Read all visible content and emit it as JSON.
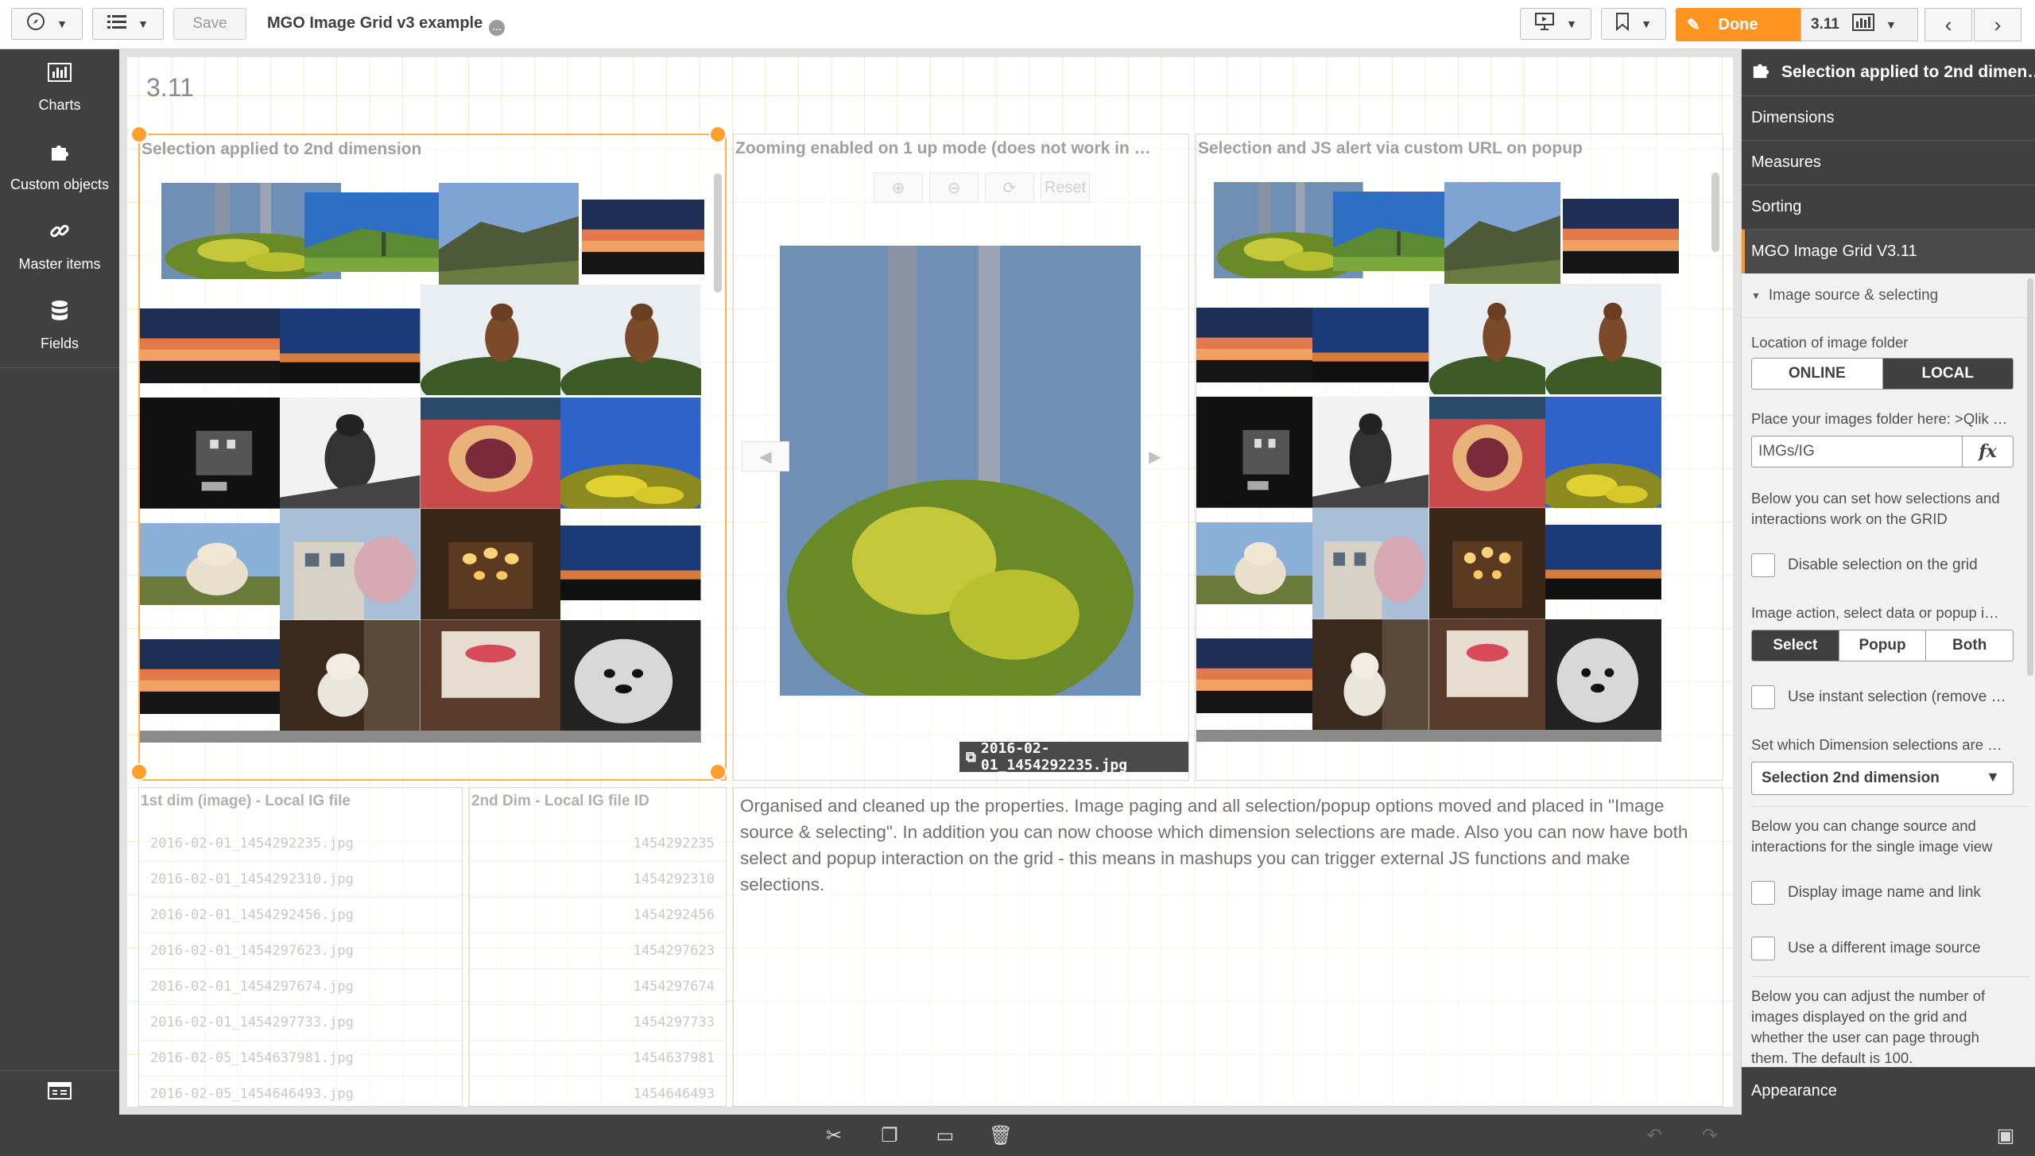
{
  "topbar": {
    "save_label": "Save",
    "app_title": "MGO Image Grid v3 example",
    "done_label": "Done",
    "version_label": "3.11"
  },
  "leftbar": {
    "items": [
      {
        "label": "Charts",
        "icon": "bar-chart-icon"
      },
      {
        "label": "Custom objects",
        "icon": "puzzle-icon"
      },
      {
        "label": "Master items",
        "icon": "link-icon"
      },
      {
        "label": "Fields",
        "icon": "database-icon"
      }
    ]
  },
  "sheet": {
    "title": "3.11",
    "obj1_title": "Selection applied to 2nd dimension",
    "obj2_title": "Zooming enabled on 1 up mode (does not work in …",
    "obj3_title": "Selection and JS alert via custom URL on popup",
    "zoom_reset": "Reset",
    "caption": "2016-02-01_1454292235.jpg",
    "table1": {
      "title": "1st dim (image) - Local IG file",
      "rows": [
        "2016-02-01_1454292235.jpg",
        "2016-02-01_1454292310.jpg",
        "2016-02-01_1454292456.jpg",
        "2016-02-01_1454297623.jpg",
        "2016-02-01_1454297674.jpg",
        "2016-02-01_1454297733.jpg",
        "2016-02-05_1454637981.jpg",
        "2016-02-05_1454646493.jpg"
      ]
    },
    "table2": {
      "title": "2nd Dim - Local IG file ID",
      "rows": [
        "1454292235",
        "1454292310",
        "1454292456",
        "1454297623",
        "1454297674",
        "1454297733",
        "1454637981",
        "1454646493"
      ]
    },
    "text_body": "Organised and cleaned up the properties. Image paging and all selection/popup options moved and placed in \"Image source & selecting\". In addition you can now choose which dimension selections are made. Also you can now have both select and popup interaction on the grid - this means in mashups you can trigger external JS functions and make selections."
  },
  "rpanel": {
    "header": "Selection applied to 2nd dimen…",
    "sections": [
      "Dimensions",
      "Measures",
      "Sorting",
      "MGO Image Grid V3.11"
    ],
    "subsection": "Image source & selecting",
    "location_label": "Location of image folder",
    "location_opts": [
      "ONLINE",
      "LOCAL"
    ],
    "folder_label": "Place your images folder here: >Qlik …",
    "folder_value": "IMGs/IG",
    "fx_label": "fx",
    "sel_desc": "Below you can set how selections and interactions work on the GRID",
    "disable_sel": "Disable selection on the grid",
    "action_label": "Image action, select data or popup i…",
    "action_opts": [
      "Select",
      "Popup",
      "Both"
    ],
    "instant_sel": "Use instant selection (remove …",
    "dim_sel_label": "Set which Dimension selections are …",
    "dim_sel_value": "Selection 2nd dimension",
    "single_desc": "Below you can change source and interactions for the single image view",
    "display_name": "Display image name and link",
    "diff_source": "Use a different image source",
    "paging_desc": "Below you can adjust the number of images displayed on the grid and whether the user can page through them. The default is 100.",
    "appearance": "Appearance"
  },
  "colors": {
    "accent": "#ff9421",
    "dark": "#404040"
  }
}
